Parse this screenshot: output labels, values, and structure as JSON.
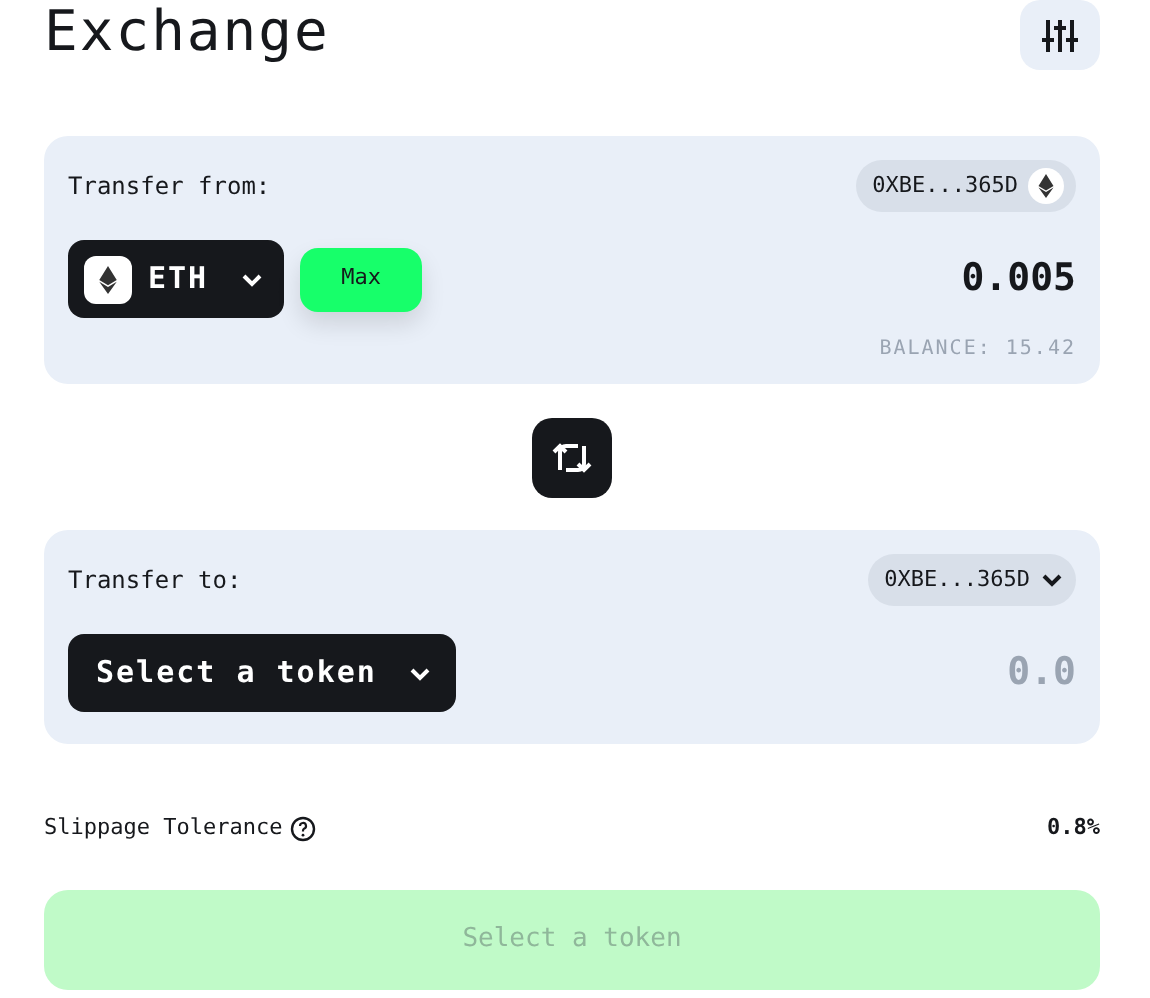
{
  "title": "Exchange",
  "from": {
    "label": "Transfer from:",
    "address": {
      "text": "0XBE...365D",
      "kind": "network"
    },
    "token": {
      "text": "ETH",
      "kind": "eth"
    },
    "max": "Max",
    "amount": "0.005",
    "balance": "BALANCE: 15.42"
  },
  "to": {
    "label": "Transfer to:",
    "address": {
      "text": "0XBE...365D",
      "kind": "dropdown"
    },
    "token": {
      "text": "Select a token",
      "kind": "none"
    },
    "placeholder": "0.0"
  },
  "slippage": {
    "label": "Slippage Tolerance",
    "value": "0.8%"
  },
  "submit": {
    "label": "Select a token",
    "disabled": true
  }
}
